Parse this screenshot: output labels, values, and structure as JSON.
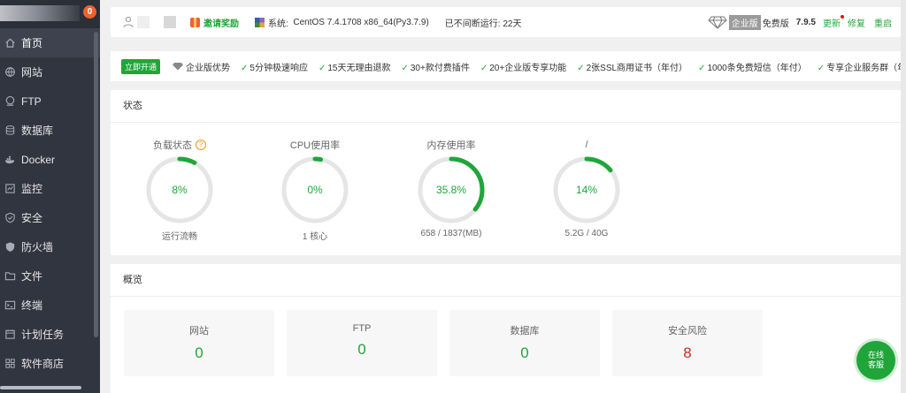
{
  "sidebar": {
    "badge": "0",
    "items": [
      {
        "label": "首页",
        "icon": "home-icon",
        "active": true
      },
      {
        "label": "网站",
        "icon": "globe-icon"
      },
      {
        "label": "FTP",
        "icon": "ftp-icon"
      },
      {
        "label": "数据库",
        "icon": "database-icon"
      },
      {
        "label": "Docker",
        "icon": "docker-icon"
      },
      {
        "label": "监控",
        "icon": "monitor-icon"
      },
      {
        "label": "安全",
        "icon": "shield-icon"
      },
      {
        "label": "防火墙",
        "icon": "firewall-icon"
      },
      {
        "label": "文件",
        "icon": "folder-icon"
      },
      {
        "label": "终端",
        "icon": "terminal-icon"
      },
      {
        "label": "计划任务",
        "icon": "calendar-icon"
      },
      {
        "label": "软件商店",
        "icon": "grid-icon"
      }
    ]
  },
  "topbar": {
    "invite": "邀请奖励",
    "system_label": "系统:",
    "system_value": "CentOS 7.4.1708 x86_64(Py3.7.9)",
    "uptime": "已不间断运行: 22天",
    "enterprise": "企业版",
    "free": "免费版",
    "version": "7.9.5",
    "update": "更新",
    "repair": "修复",
    "restart": "重启"
  },
  "promo": {
    "open_button": "立即开通",
    "advantage": "企业版优势",
    "features": [
      "5分钟极速响应",
      "15天无理由退款",
      "30+款付费插件",
      "20+企业版专享功能",
      "2张SSL商用证书（年付）",
      "1000条免费短信（年付）",
      "专享企业服务群（年付"
    ]
  },
  "status": {
    "title": "状态",
    "gauges": [
      {
        "title": "负载状态",
        "value_text": "8%",
        "percent": 8,
        "sub": "运行流畅",
        "help": "?"
      },
      {
        "title": "CPU使用率",
        "value_text": "0%",
        "percent": 0,
        "sub": "1 核心"
      },
      {
        "title": "内存使用率",
        "value_text": "35.8%",
        "percent": 35.8,
        "sub": "658 / 1837(MB)"
      },
      {
        "title": "/",
        "value_text": "14%",
        "percent": 14,
        "sub": "5.2G / 40G"
      }
    ]
  },
  "overview": {
    "title": "概览",
    "cards": [
      {
        "label": "网站",
        "value": "0"
      },
      {
        "label": "FTP",
        "value": "0"
      },
      {
        "label": "数据库",
        "value": "0"
      },
      {
        "label": "安全风险",
        "value": "8",
        "danger": true
      }
    ]
  },
  "chat": {
    "line1": "在线",
    "line2": "客服"
  },
  "colors": {
    "accent": "#20a53a",
    "danger": "#e02020",
    "sidebar": "#31353f"
  }
}
